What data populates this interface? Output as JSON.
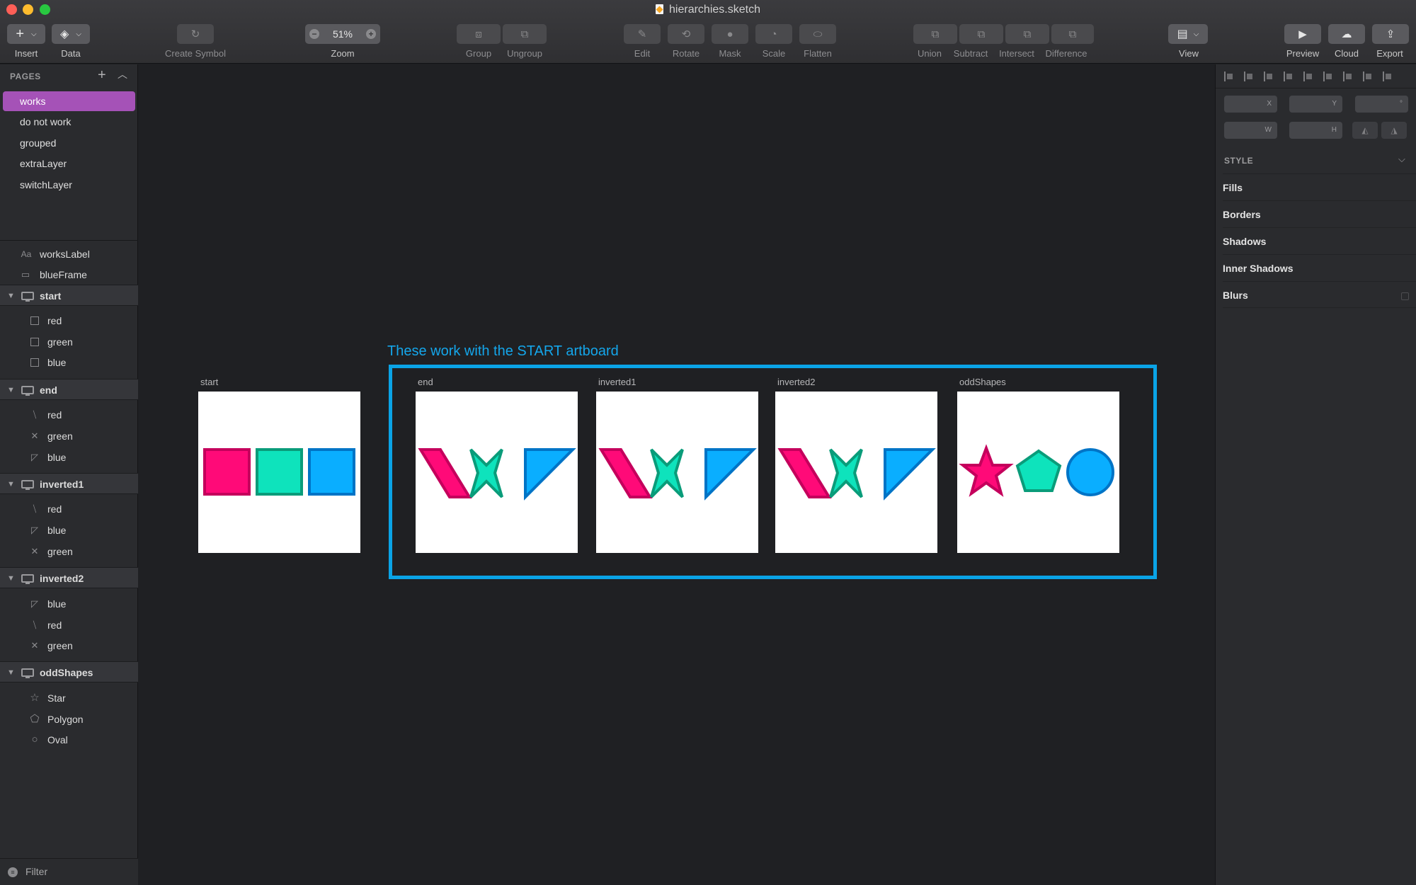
{
  "window": {
    "title": "hierarchies.sketch"
  },
  "toolbar": {
    "insert": "Insert",
    "data": "Data",
    "create_symbol": "Create Symbol",
    "zoom_label": "Zoom",
    "zoom_value": "51%",
    "group": "Group",
    "ungroup": "Ungroup",
    "edit": "Edit",
    "rotate": "Rotate",
    "mask": "Mask",
    "scale": "Scale",
    "flatten": "Flatten",
    "union": "Union",
    "subtract": "Subtract",
    "intersect": "Intersect",
    "difference": "Difference",
    "view": "View",
    "preview": "Preview",
    "cloud": "Cloud",
    "export": "Export"
  },
  "pages": {
    "header": "PAGES",
    "items": [
      "works",
      "do not work",
      "grouped",
      "extraLayer",
      "switchLayer"
    ],
    "active": "works"
  },
  "layers": {
    "top": [
      {
        "icon": "text-layer-icon",
        "label": "worksLabel",
        "glyph": "Aa"
      },
      {
        "icon": "rectangle-layer-icon",
        "label": "blueFrame",
        "glyph": "▭"
      }
    ],
    "groups": [
      {
        "name": "start",
        "children": [
          {
            "icon": "square-icon",
            "label": "red"
          },
          {
            "icon": "square-icon",
            "label": "green"
          },
          {
            "icon": "square-icon",
            "label": "blue"
          }
        ]
      },
      {
        "name": "end",
        "children": [
          {
            "icon": "parallelogram-icon",
            "label": "red"
          },
          {
            "icon": "cross-icon",
            "label": "green"
          },
          {
            "icon": "triangle-icon",
            "label": "blue"
          }
        ]
      },
      {
        "name": "inverted1",
        "children": [
          {
            "icon": "parallelogram-icon",
            "label": "red"
          },
          {
            "icon": "triangle-icon",
            "label": "blue"
          },
          {
            "icon": "cross-icon",
            "label": "green"
          }
        ]
      },
      {
        "name": "inverted2",
        "children": [
          {
            "icon": "triangle-icon",
            "label": "blue"
          },
          {
            "icon": "parallelogram-icon",
            "label": "red"
          },
          {
            "icon": "cross-icon",
            "label": "green"
          }
        ]
      },
      {
        "name": "oddShapes",
        "children": [
          {
            "icon": "star-icon",
            "label": "Star"
          },
          {
            "icon": "polygon-icon",
            "label": "Polygon"
          },
          {
            "icon": "oval-icon",
            "label": "Oval"
          }
        ]
      }
    ]
  },
  "filter": {
    "label": "Filter"
  },
  "canvas": {
    "works_label": "These work with the START artboard",
    "artboards": {
      "start": "start",
      "end": "end",
      "inverted1": "inverted1",
      "inverted2": "inverted2",
      "oddShapes": "oddShapes"
    },
    "colors": {
      "red_fill": "#ff0a78",
      "red_stroke": "#c4005c",
      "green_fill": "#0ee3bc",
      "green_stroke": "#0a9c7a",
      "blue_fill": "#0aaeff",
      "blue_stroke": "#0074c6",
      "frame": "#0aa3e6"
    }
  },
  "inspector": {
    "fields": {
      "x": "X",
      "y": "Y",
      "rotation": "°",
      "w": "W",
      "h": "H"
    },
    "style_header": "STYLE",
    "sections": [
      "Fills",
      "Borders",
      "Shadows",
      "Inner Shadows",
      "Blurs"
    ]
  }
}
